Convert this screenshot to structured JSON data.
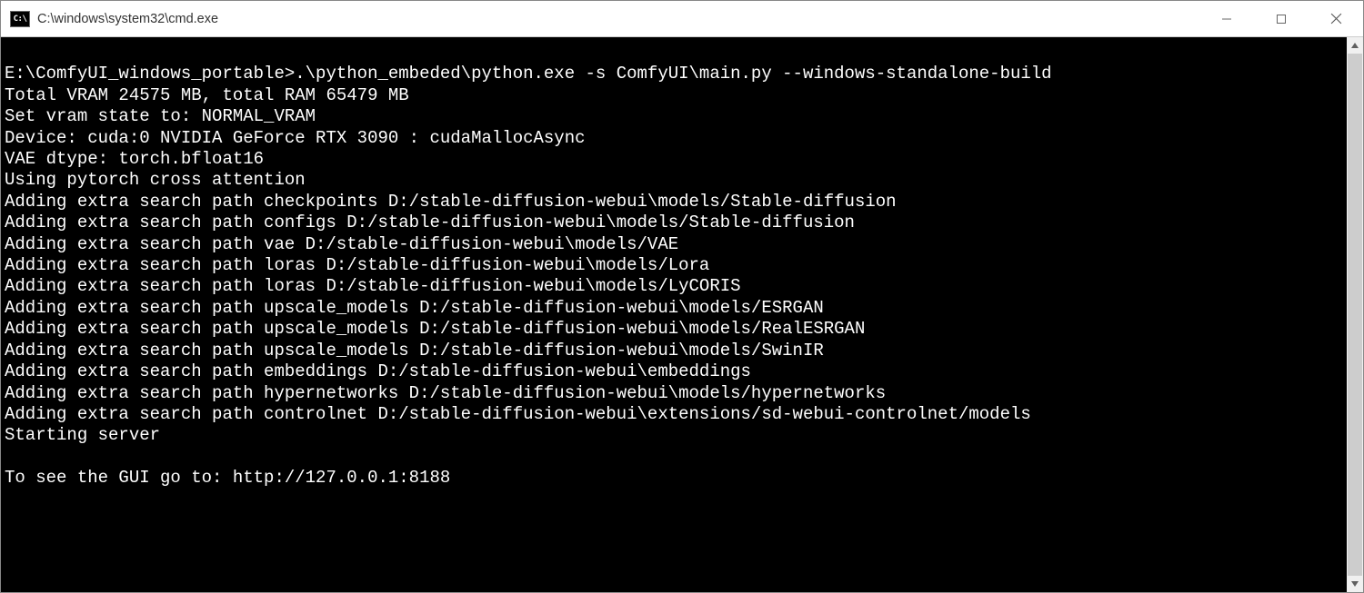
{
  "window": {
    "icon_label": "C:\\",
    "title": "C:\\windows\\system32\\cmd.exe"
  },
  "terminal": {
    "lines": [
      "",
      "E:\\ComfyUI_windows_portable>.\\python_embeded\\python.exe -s ComfyUI\\main.py --windows-standalone-build",
      "Total VRAM 24575 MB, total RAM 65479 MB",
      "Set vram state to: NORMAL_VRAM",
      "Device: cuda:0 NVIDIA GeForce RTX 3090 : cudaMallocAsync",
      "VAE dtype: torch.bfloat16",
      "Using pytorch cross attention",
      "Adding extra search path checkpoints D:/stable-diffusion-webui\\models/Stable-diffusion",
      "Adding extra search path configs D:/stable-diffusion-webui\\models/Stable-diffusion",
      "Adding extra search path vae D:/stable-diffusion-webui\\models/VAE",
      "Adding extra search path loras D:/stable-diffusion-webui\\models/Lora",
      "Adding extra search path loras D:/stable-diffusion-webui\\models/LyCORIS",
      "Adding extra search path upscale_models D:/stable-diffusion-webui\\models/ESRGAN",
      "Adding extra search path upscale_models D:/stable-diffusion-webui\\models/RealESRGAN",
      "Adding extra search path upscale_models D:/stable-diffusion-webui\\models/SwinIR",
      "Adding extra search path embeddings D:/stable-diffusion-webui\\embeddings",
      "Adding extra search path hypernetworks D:/stable-diffusion-webui\\models/hypernetworks",
      "Adding extra search path controlnet D:/stable-diffusion-webui\\extensions/sd-webui-controlnet/models",
      "Starting server",
      "",
      "To see the GUI go to: http://127.0.0.1:8188"
    ]
  }
}
